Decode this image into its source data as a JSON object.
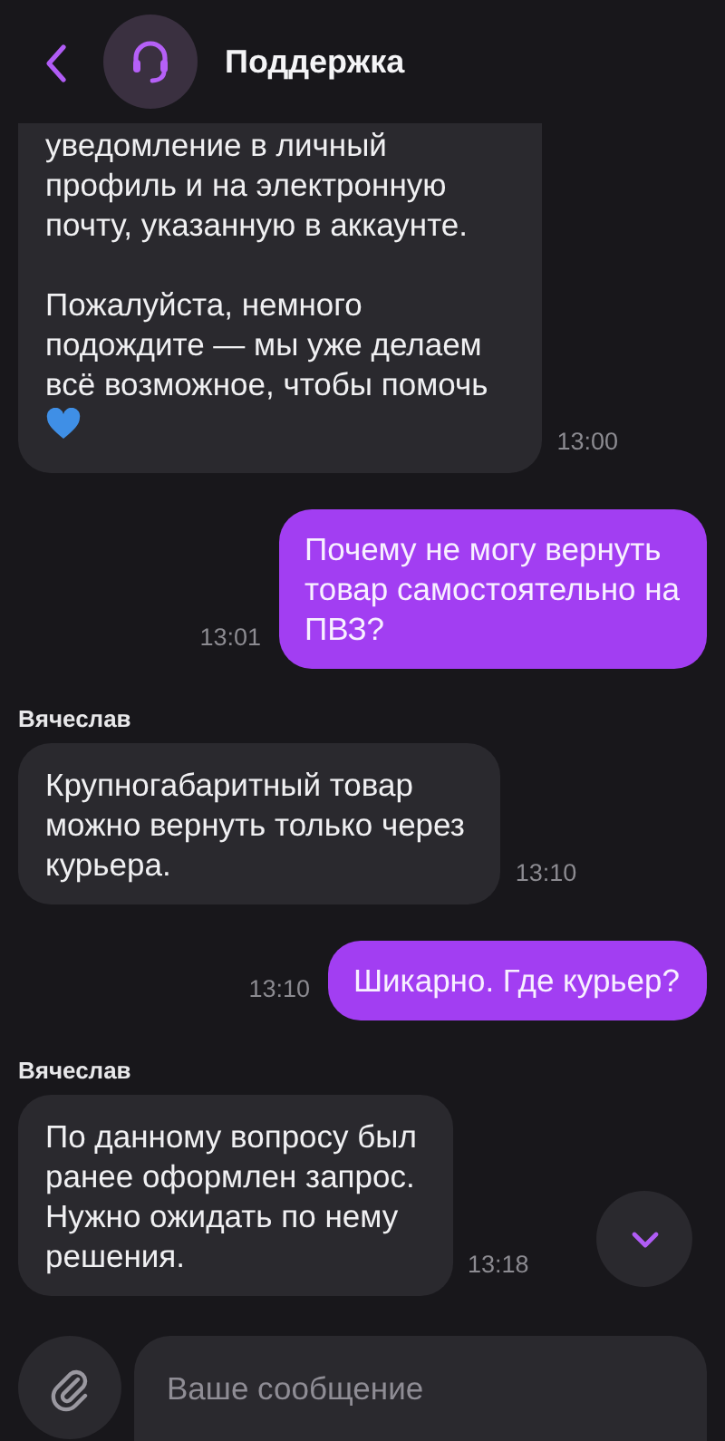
{
  "header": {
    "title": "Поддержка"
  },
  "messages": [
    {
      "kind": "incoming",
      "paragraphs": [
        "уведомление в личный\nпрофиль и на электронную\nпочту, указанную в аккаунте.",
        "Пожалуйста, немного\nподождите — мы уже делаем\nвсё возможное, чтобы помочь"
      ],
      "has_emoji": true,
      "time": "13:00"
    },
    {
      "kind": "outgoing",
      "paragraphs": [
        "Почему не могу вернуть\nтовар самостоятельно на\nПВЗ?"
      ],
      "time": "13:01"
    },
    {
      "kind": "incoming",
      "sender": "Вячеслав",
      "paragraphs": [
        "Крупногабаритный товар\nможно вернуть только через\nкурьера."
      ],
      "time": "13:10"
    },
    {
      "kind": "outgoing",
      "paragraphs": [
        "Шикарно. Где курьер?"
      ],
      "time": "13:10"
    },
    {
      "kind": "incoming",
      "sender": "Вячеслав",
      "paragraphs": [
        "По данному вопросу был\nранее оформлен запрос.\nНужно ожидать по нему\nрешения."
      ],
      "time": "13:18"
    }
  ],
  "composer": {
    "placeholder": "Ваше сообщение"
  }
}
